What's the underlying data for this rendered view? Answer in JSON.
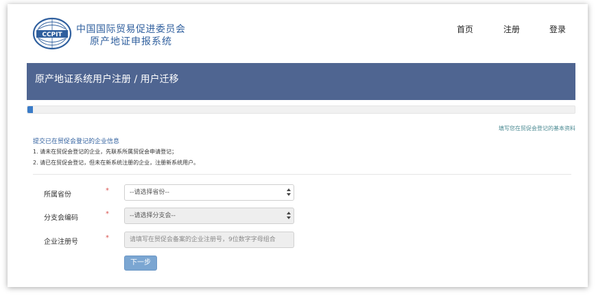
{
  "header": {
    "org_name": "中国国际贸易促进委员会",
    "system_name": "原产地证申报系统",
    "logo_text": "CCPIT",
    "nav": [
      {
        "label": "首页"
      },
      {
        "label": "注册"
      },
      {
        "label": "登录"
      }
    ]
  },
  "banner": {
    "title": "原产地证系统用户注册 / 用户迁移"
  },
  "progress": {
    "value_fraction": 0.01
  },
  "step_hint": "填写您在贸促会登记的基本资料",
  "info": {
    "title": "提交已在贸促会登记的企业信息",
    "lines": [
      "1. 请未在贸促会登记的企业，先联系所属贸促会申请登记；",
      "2. 请已在贸促会登记，但未在新系统注册的企业，注册新系统用户。"
    ]
  },
  "form": {
    "province": {
      "label": "所属省份",
      "required_mark": "*",
      "selected": "--请选择省份--"
    },
    "branch": {
      "label": "分支会编码",
      "required_mark": "*",
      "selected": "--请选择分支会--"
    },
    "reg_no": {
      "label": "企业注册号",
      "required_mark": "*",
      "placeholder": "请填写在贸促会备案的企业注册号，9位数字字母组合"
    },
    "next_label": "下一步"
  },
  "colors": {
    "brand_blue": "#2f5f9e",
    "banner_bg": "#4f6591",
    "required": "#d9534f",
    "button": "#7ba6d2"
  }
}
